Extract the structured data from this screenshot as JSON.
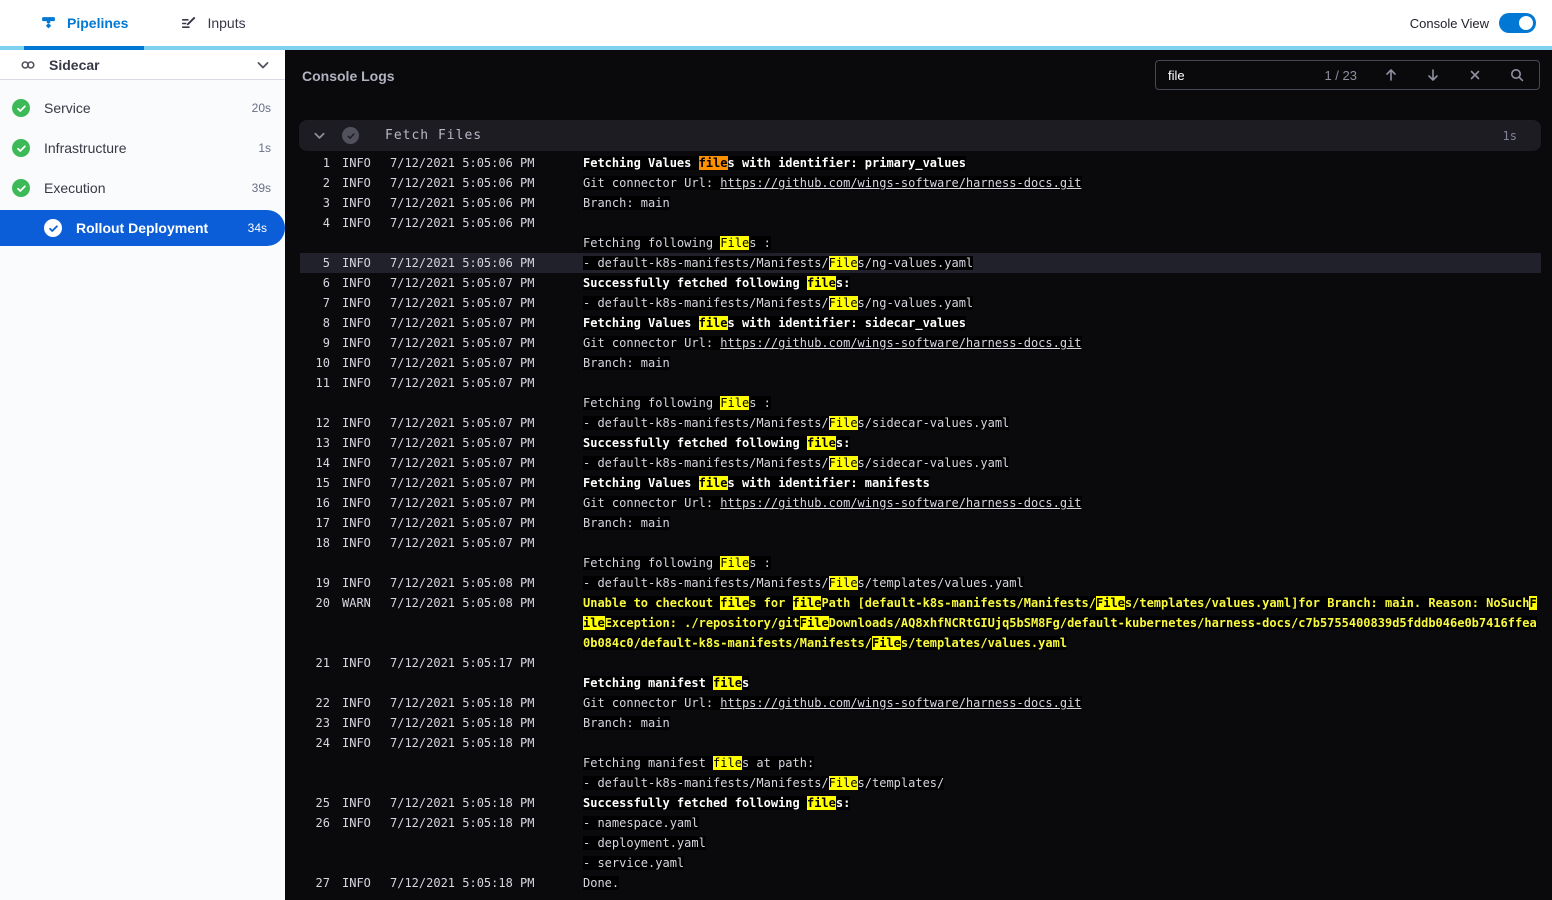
{
  "topbar": {
    "tabs": [
      {
        "label": "Pipelines",
        "active": true
      },
      {
        "label": "Inputs",
        "active": false
      }
    ],
    "console_view_label": "Console View",
    "console_view_on": true
  },
  "sidebar": {
    "title": "Sidecar",
    "items": [
      {
        "label": "Service",
        "duration": "20s",
        "status": "success"
      },
      {
        "label": "Infrastructure",
        "duration": "1s",
        "status": "success"
      },
      {
        "label": "Execution",
        "duration": "39s",
        "status": "success"
      },
      {
        "label": "Rollout Deployment",
        "duration": "34s",
        "status": "success",
        "selected": true
      }
    ]
  },
  "console": {
    "title": "Console Logs",
    "search": {
      "query": "file",
      "counter": "1 / 23"
    },
    "section": {
      "title": "Fetch Files",
      "duration": "1s"
    }
  },
  "colors": {
    "accent_blue": "#0278d5",
    "accent_cyan": "#7fd0ee",
    "selected_blue": "#0b5ed7",
    "success_green": "#3eb957",
    "console_bg": "#0a0a0d",
    "match_highlight": "#ffff00",
    "current_match_highlight": "#ff9000",
    "warn_text": "#f8f83e"
  },
  "log": {
    "lines": [
      {
        "n": 1,
        "lv": "INFO",
        "t": "7/12/2021 5:05:06 PM",
        "rows": [
          {
            "c": "b",
            "s": [
              {
                "t": "Fetching Values "
              },
              {
                "t": "file",
                "h": "cur"
              },
              {
                "t": "s with identifier: primary_values"
              }
            ]
          }
        ]
      },
      {
        "n": 2,
        "lv": "INFO",
        "t": "7/12/2021 5:05:06 PM",
        "rows": [
          {
            "s": [
              {
                "t": "Git connector Url: "
              },
              {
                "t": "https://github.com/wings-software/harness-docs.git",
                "u": true
              }
            ]
          }
        ]
      },
      {
        "n": 3,
        "lv": "INFO",
        "t": "7/12/2021 5:05:06 PM",
        "rows": [
          {
            "s": [
              {
                "t": "Branch: main"
              }
            ]
          }
        ]
      },
      {
        "n": 4,
        "lv": "INFO",
        "t": "7/12/2021 5:05:06 PM",
        "rows": [
          {
            "s": []
          },
          {
            "s": [
              {
                "t": "Fetching following "
              },
              {
                "t": "File",
                "h": "m"
              },
              {
                "t": "s :"
              }
            ]
          }
        ]
      },
      {
        "n": 5,
        "lv": "INFO",
        "t": "7/12/2021 5:05:06 PM",
        "hl": true,
        "rows": [
          {
            "s": [
              {
                "t": "- default-k8s-manifests/Manifests/"
              },
              {
                "t": "File",
                "h": "m"
              },
              {
                "t": "s/ng-values.yaml"
              }
            ]
          }
        ]
      },
      {
        "n": 6,
        "lv": "INFO",
        "t": "7/12/2021 5:05:07 PM",
        "rows": [
          {
            "c": "b",
            "s": [
              {
                "t": "Successfully fetched following "
              },
              {
                "t": "file",
                "h": "m"
              },
              {
                "t": "s:"
              }
            ]
          }
        ]
      },
      {
        "n": 7,
        "lv": "INFO",
        "t": "7/12/2021 5:05:07 PM",
        "rows": [
          {
            "s": [
              {
                "t": "- default-k8s-manifests/Manifests/"
              },
              {
                "t": "File",
                "h": "m"
              },
              {
                "t": "s/ng-values.yaml"
              }
            ]
          }
        ]
      },
      {
        "n": 8,
        "lv": "INFO",
        "t": "7/12/2021 5:05:07 PM",
        "rows": [
          {
            "c": "b",
            "s": [
              {
                "t": "Fetching Values "
              },
              {
                "t": "file",
                "h": "m"
              },
              {
                "t": "s with identifier: sidecar_values"
              }
            ]
          }
        ]
      },
      {
        "n": 9,
        "lv": "INFO",
        "t": "7/12/2021 5:05:07 PM",
        "rows": [
          {
            "s": [
              {
                "t": "Git connector Url: "
              },
              {
                "t": "https://github.com/wings-software/harness-docs.git",
                "u": true
              }
            ]
          }
        ]
      },
      {
        "n": 10,
        "lv": "INFO",
        "t": "7/12/2021 5:05:07 PM",
        "rows": [
          {
            "s": [
              {
                "t": "Branch: main"
              }
            ]
          }
        ]
      },
      {
        "n": 11,
        "lv": "INFO",
        "t": "7/12/2021 5:05:07 PM",
        "rows": [
          {
            "s": []
          },
          {
            "s": [
              {
                "t": "Fetching following "
              },
              {
                "t": "File",
                "h": "m"
              },
              {
                "t": "s :"
              }
            ]
          }
        ]
      },
      {
        "n": 12,
        "lv": "INFO",
        "t": "7/12/2021 5:05:07 PM",
        "rows": [
          {
            "s": [
              {
                "t": "- default-k8s-manifests/Manifests/"
              },
              {
                "t": "File",
                "h": "m"
              },
              {
                "t": "s/sidecar-values.yaml"
              }
            ]
          }
        ]
      },
      {
        "n": 13,
        "lv": "INFO",
        "t": "7/12/2021 5:05:07 PM",
        "rows": [
          {
            "c": "b",
            "s": [
              {
                "t": "Successfully fetched following "
              },
              {
                "t": "file",
                "h": "m"
              },
              {
                "t": "s:"
              }
            ]
          }
        ]
      },
      {
        "n": 14,
        "lv": "INFO",
        "t": "7/12/2021 5:05:07 PM",
        "rows": [
          {
            "s": [
              {
                "t": "- default-k8s-manifests/Manifests/"
              },
              {
                "t": "File",
                "h": "m"
              },
              {
                "t": "s/sidecar-values.yaml"
              }
            ]
          }
        ]
      },
      {
        "n": 15,
        "lv": "INFO",
        "t": "7/12/2021 5:05:07 PM",
        "rows": [
          {
            "c": "b",
            "s": [
              {
                "t": "Fetching Values "
              },
              {
                "t": "file",
                "h": "m"
              },
              {
                "t": "s with identifier: manifests"
              }
            ]
          }
        ]
      },
      {
        "n": 16,
        "lv": "INFO",
        "t": "7/12/2021 5:05:07 PM",
        "rows": [
          {
            "s": [
              {
                "t": "Git connector Url: "
              },
              {
                "t": "https://github.com/wings-software/harness-docs.git",
                "u": true
              }
            ]
          }
        ]
      },
      {
        "n": 17,
        "lv": "INFO",
        "t": "7/12/2021 5:05:07 PM",
        "rows": [
          {
            "s": [
              {
                "t": "Branch: main"
              }
            ]
          }
        ]
      },
      {
        "n": 18,
        "lv": "INFO",
        "t": "7/12/2021 5:05:07 PM",
        "rows": [
          {
            "s": []
          },
          {
            "s": [
              {
                "t": "Fetching following "
              },
              {
                "t": "File",
                "h": "m"
              },
              {
                "t": "s :"
              }
            ]
          }
        ]
      },
      {
        "n": 19,
        "lv": "INFO",
        "t": "7/12/2021 5:05:08 PM",
        "rows": [
          {
            "s": [
              {
                "t": "- default-k8s-manifests/Manifests/"
              },
              {
                "t": "File",
                "h": "m"
              },
              {
                "t": "s/templates/values.yaml"
              }
            ]
          }
        ]
      },
      {
        "n": 20,
        "lv": "WARN",
        "t": "7/12/2021 5:05:08 PM",
        "rows": [
          {
            "c": "w",
            "s": [
              {
                "t": "Unable to checkout "
              },
              {
                "t": "file",
                "h": "m"
              },
              {
                "t": "s for "
              },
              {
                "t": "file",
                "h": "m"
              },
              {
                "t": "Path [default-k8s-manifests/Manifests/"
              },
              {
                "t": "File",
                "h": "m"
              },
              {
                "t": "s/templates/values.yaml]for Branch: main. Reason: NoSuch"
              },
              {
                "t": "File",
                "h": "m"
              },
              {
                "t": "Exception: ./repository/git"
              },
              {
                "t": "File",
                "h": "m"
              },
              {
                "t": "Downloads/AQ8xhfNCRtGIUjq5bSM8Fg/default-kubernetes/harness-docs/c7b5755400839d5fddb046e0b7416ffea0b084c0/default-k8s-manifests/Manifests/"
              },
              {
                "t": "File",
                "h": "m"
              },
              {
                "t": "s/templates/values.yaml"
              }
            ]
          }
        ]
      },
      {
        "n": 21,
        "lv": "INFO",
        "t": "7/12/2021 5:05:17 PM",
        "rows": [
          {
            "s": []
          },
          {
            "c": "b",
            "s": [
              {
                "t": "Fetching manifest "
              },
              {
                "t": "file",
                "h": "m"
              },
              {
                "t": "s"
              }
            ]
          }
        ]
      },
      {
        "n": 22,
        "lv": "INFO",
        "t": "7/12/2021 5:05:18 PM",
        "rows": [
          {
            "s": [
              {
                "t": "Git connector Url: "
              },
              {
                "t": "https://github.com/wings-software/harness-docs.git",
                "u": true
              }
            ]
          }
        ]
      },
      {
        "n": 23,
        "lv": "INFO",
        "t": "7/12/2021 5:05:18 PM",
        "rows": [
          {
            "s": [
              {
                "t": "Branch: main"
              }
            ]
          }
        ]
      },
      {
        "n": 24,
        "lv": "INFO",
        "t": "7/12/2021 5:05:18 PM",
        "rows": [
          {
            "s": []
          },
          {
            "s": [
              {
                "t": "Fetching manifest "
              },
              {
                "t": "file",
                "h": "m"
              },
              {
                "t": "s at path:"
              }
            ]
          },
          {
            "s": [
              {
                "t": "- default-k8s-manifests/Manifests/"
              },
              {
                "t": "File",
                "h": "m"
              },
              {
                "t": "s/templates/"
              }
            ]
          }
        ]
      },
      {
        "n": 25,
        "lv": "INFO",
        "t": "7/12/2021 5:05:18 PM",
        "rows": [
          {
            "c": "b",
            "s": [
              {
                "t": "Successfully fetched following "
              },
              {
                "t": "file",
                "h": "m"
              },
              {
                "t": "s:"
              }
            ]
          }
        ]
      },
      {
        "n": 26,
        "lv": "INFO",
        "t": "7/12/2021 5:05:18 PM",
        "rows": [
          {
            "s": [
              {
                "t": "- namespace.yaml"
              }
            ]
          },
          {
            "s": [
              {
                "t": "- deployment.yaml"
              }
            ]
          },
          {
            "s": [
              {
                "t": "- service.yaml"
              }
            ]
          }
        ]
      },
      {
        "n": 27,
        "lv": "INFO",
        "t": "7/12/2021 5:05:18 PM",
        "rows": [
          {
            "s": [
              {
                "t": "Done."
              }
            ]
          }
        ]
      }
    ]
  }
}
